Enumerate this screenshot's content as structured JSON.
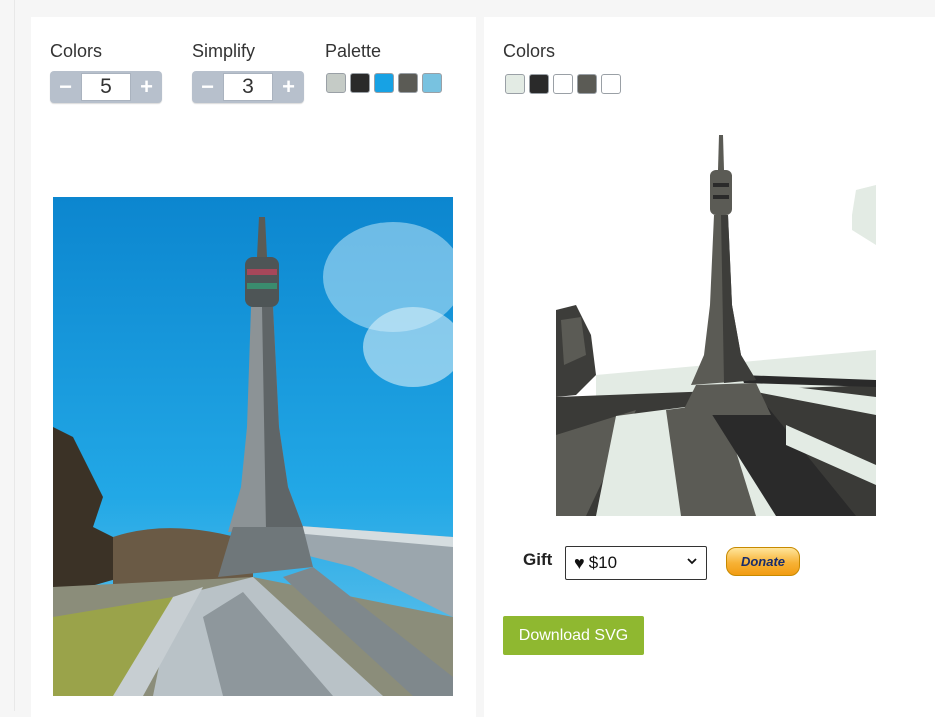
{
  "left_panel": {
    "colors": {
      "label": "Colors",
      "value": "5",
      "minus": "−",
      "plus": "+"
    },
    "simplify": {
      "label": "Simplify",
      "value": "3",
      "minus": "−",
      "plus": "+"
    },
    "palette": {
      "label": "Palette",
      "swatches": [
        "#c5cbc6",
        "#2a2a2a",
        "#17a2e4",
        "#5b5b55",
        "#78c2e0"
      ]
    }
  },
  "right_panel": {
    "colors_label": "Colors",
    "swatches": [
      "#e3ebe4",
      "#2a2a2a",
      "#ffffff",
      "#5b5b55",
      "#ffffff"
    ]
  },
  "gift": {
    "label": "Gift",
    "selected": "$10",
    "heart": "♥"
  },
  "donate_label": "Donate",
  "download_label": "Download SVG",
  "icons": {
    "minus": "minus-icon",
    "plus": "plus-icon",
    "heart": "heart-icon",
    "chevron": "chevron-down-icon"
  }
}
